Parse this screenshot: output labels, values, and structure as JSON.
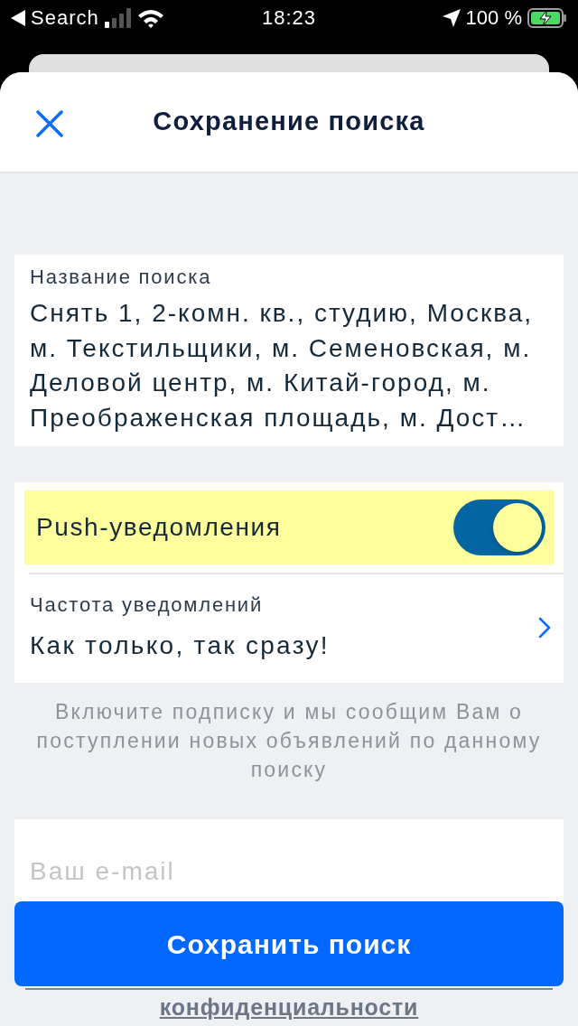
{
  "status_bar": {
    "back_label": "Search",
    "time": "18:23",
    "battery_percent": "100 %",
    "charging": true
  },
  "header": {
    "title": "Сохранение поиска"
  },
  "search_name": {
    "label": "Название поиска",
    "value": "Снять 1, 2-комн. кв., студию, Москва, м. Текстильщики, м. Семеновская, м. Деловой центр, м. Китай-город, м. Преображенская площадь, м. Дост…"
  },
  "push": {
    "label": "Push-уведомления",
    "on": true,
    "highlighted": true
  },
  "frequency": {
    "label": "Частота уведомлений",
    "value": "Как только, так сразу!"
  },
  "hint": "Включите подписку и мы сообщим Вам о поступлении новых объявлений по данному поиску",
  "email": {
    "placeholder": "Ваш e-mail"
  },
  "save_button": {
    "label": "Сохранить поиск"
  },
  "privacy_link": "конфиденциальности"
}
